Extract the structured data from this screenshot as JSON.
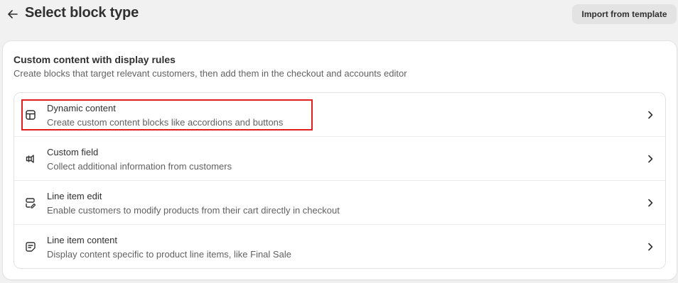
{
  "header": {
    "title": "Select block type",
    "back_icon": "arrow-left-icon",
    "import_button": "Import from template"
  },
  "card": {
    "title": "Custom content with display rules",
    "subtitle": "Create blocks that target relevant customers, then add them in the checkout and accounts editor"
  },
  "block_types": [
    {
      "title": "Dynamic content",
      "description": "Create custom content blocks like accordions and buttons",
      "icon": "layout-icon",
      "highlighted": true
    },
    {
      "title": "Custom field",
      "description": "Collect additional information from customers",
      "icon": "custom-field-icon",
      "highlighted": false
    },
    {
      "title": "Line item edit",
      "description": "Enable customers to modify products from their cart directly in checkout",
      "icon": "line-item-edit-icon",
      "highlighted": false
    },
    {
      "title": "Line item content",
      "description": "Display content specific to product line items, like Final Sale",
      "icon": "note-icon",
      "highlighted": false
    }
  ],
  "colors": {
    "highlight": "#e01e1e",
    "background": "#f1f1f1",
    "card": "#ffffff"
  }
}
